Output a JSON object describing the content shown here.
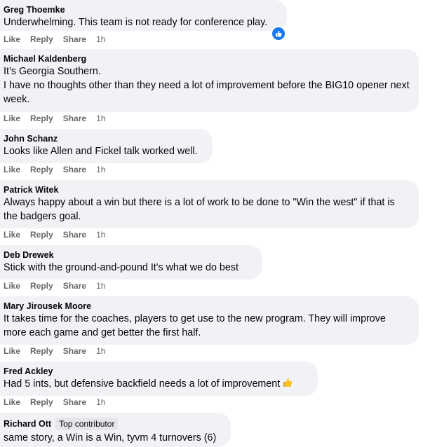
{
  "comments": [
    {
      "name": "Greg Thoemke",
      "text": "Underwhelming. This team is not ready for conference play.",
      "actions": {
        "like": "Like",
        "reply": "Reply",
        "share": "Share",
        "time": "1h"
      }
    },
    {
      "name": "Michael Kaldenberg",
      "text": "It’s Georgia Southern.\nI have no thoughts other than they need a lot of improvement before the BIG10 opener next week.",
      "actions": {
        "like": "Like",
        "reply": "Reply",
        "share": "Share",
        "time": "1h"
      }
    },
    {
      "name": "John Schanz",
      "text": "Looks like Allen and Fickel talk worked well.",
      "actions": {
        "like": "Like",
        "reply": "Reply",
        "share": "Share",
        "time": "1h"
      }
    },
    {
      "name": "Patrick Witek",
      "text": "Always happy about a win but there is a lot of work to be done to \"Win the west\" if that is the badgers goal.",
      "actions": {
        "like": "Like",
        "reply": "Reply",
        "share": "Share",
        "time": "1h"
      }
    },
    {
      "name": "Deb Drewek",
      "text": "Stick with the ground-and-pound It's what we do best",
      "actions": {
        "like": "Like",
        "reply": "Reply",
        "share": "Share",
        "time": "1h"
      }
    },
    {
      "name": "Mary Jirousek Moore",
      "text": "It takes time for the coaches, players to get use to the new program. They will improve more each game and get better the first half.",
      "actions": {
        "like": "Like",
        "reply": "Reply",
        "share": "Share",
        "time": "1h"
      }
    },
    {
      "name": "Fred Ackley",
      "text": "Had 5 ints, but defensive backfield needs a lot of improvement",
      "actions": {
        "like": "Like",
        "reply": "Reply",
        "share": "Share",
        "time": "1h"
      }
    },
    {
      "name": "Richard Ott",
      "badge": "Top contributor",
      "text": "same story, a Win is a Win, tyvm 4 turnovers (6)"
    }
  ]
}
